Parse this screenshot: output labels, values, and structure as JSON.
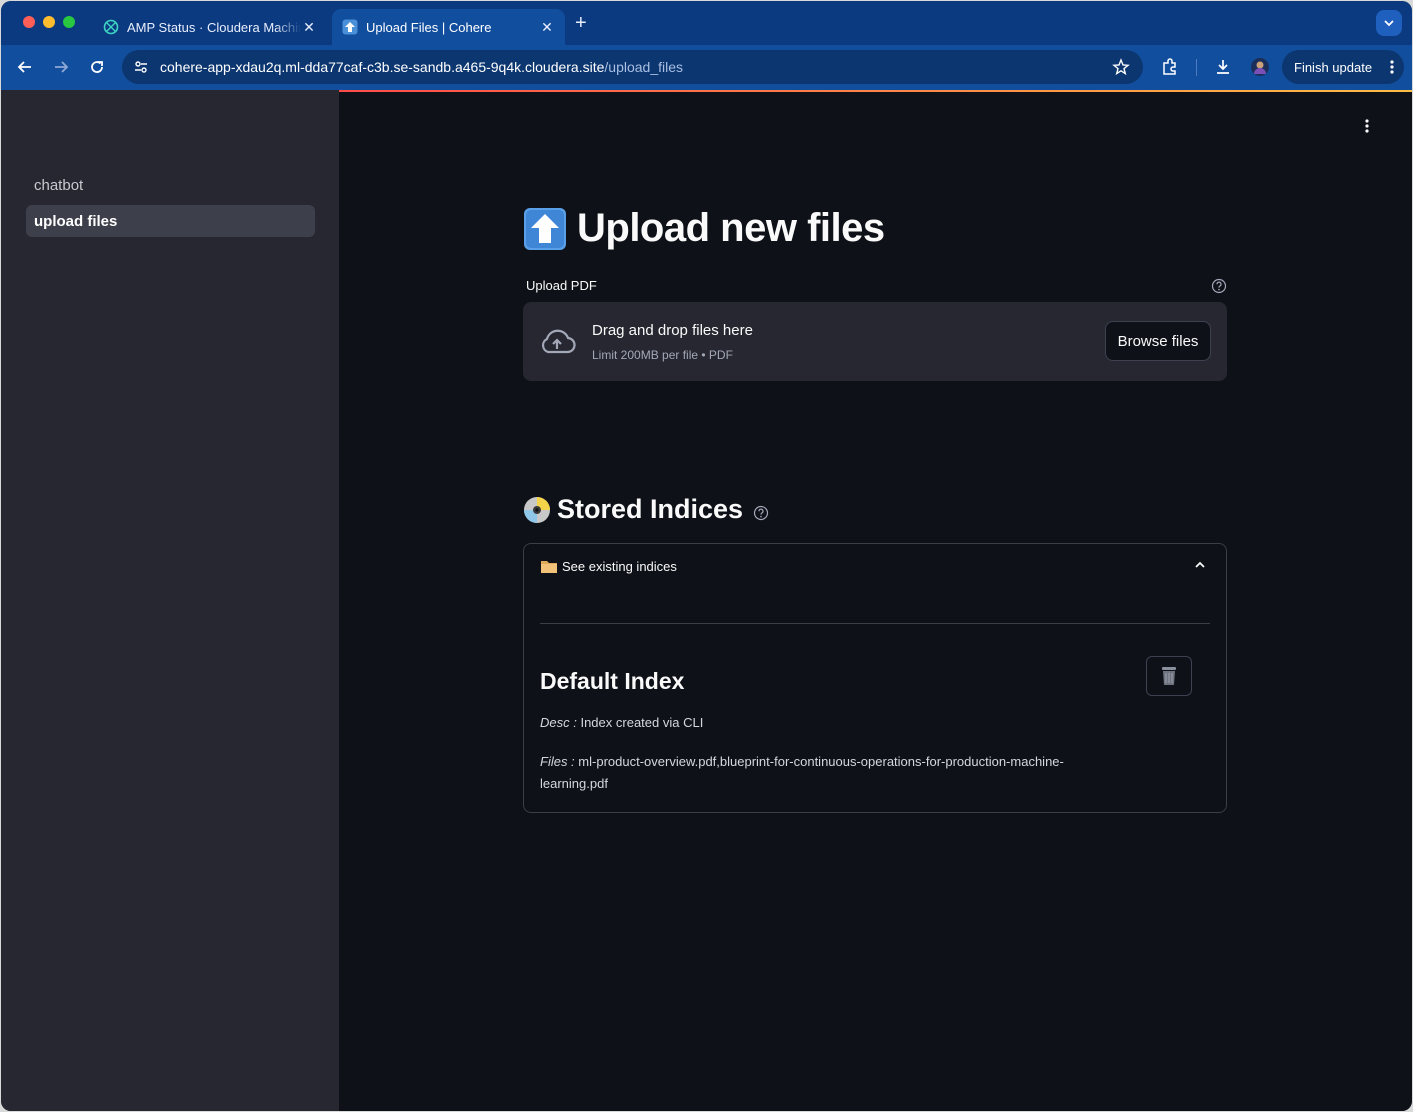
{
  "browser": {
    "tabs": [
      {
        "title": "AMP Status · Cloudera Machine Learning",
        "favicon": "cloudera-icon",
        "active": false
      },
      {
        "title": "Upload Files | Cohere",
        "favicon": "up-arrow-emoji-icon",
        "active": true
      }
    ],
    "url_host": "cohere-app-xdau2q.ml-dda77caf-c3b.se-sandb.a465-9q4k.cloudera.site",
    "url_path": "/upload_files",
    "finish_update_label": "Finish update",
    "colors": {
      "tabstrip": "#0b3a80",
      "toolbar": "#124e9e",
      "omnibox": "#0c3670"
    }
  },
  "sidebar": {
    "items": [
      {
        "label": "chatbot",
        "selected": false
      },
      {
        "label": "upload files",
        "selected": true
      }
    ]
  },
  "page": {
    "title": "Upload new files",
    "uploader": {
      "label": "Upload PDF",
      "drop_text": "Drag and drop files here",
      "limit_text": "Limit 200MB per file • PDF",
      "browse_label": "Browse files"
    },
    "stored": {
      "title": "Stored Indices",
      "expander_label": "See existing indices",
      "expanded": true,
      "index": {
        "name": "Default Index",
        "desc_label": "Desc :",
        "desc_value": "Index created via CLI",
        "files_label": "Files :",
        "files_value": "ml-product-overview.pdf,blueprint-for-continuous-operations-for-production-machine-learning.pdf"
      }
    },
    "colors": {
      "background": "#0e1117",
      "sidebar": "#262730",
      "accent": "#ff4b4b"
    }
  }
}
